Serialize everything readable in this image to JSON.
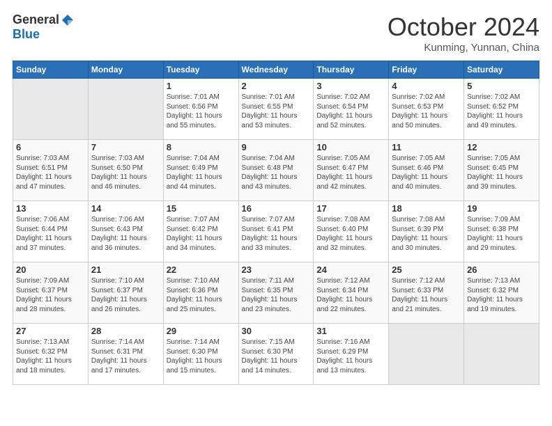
{
  "header": {
    "logo_general": "General",
    "logo_blue": "Blue",
    "month": "October 2024",
    "location": "Kunming, Yunnan, China"
  },
  "weekdays": [
    "Sunday",
    "Monday",
    "Tuesday",
    "Wednesday",
    "Thursday",
    "Friday",
    "Saturday"
  ],
  "weeks": [
    [
      {
        "day": "",
        "info": ""
      },
      {
        "day": "",
        "info": ""
      },
      {
        "day": "1",
        "info": "Sunrise: 7:01 AM\nSunset: 6:56 PM\nDaylight: 11 hours and 55 minutes."
      },
      {
        "day": "2",
        "info": "Sunrise: 7:01 AM\nSunset: 6:55 PM\nDaylight: 11 hours and 53 minutes."
      },
      {
        "day": "3",
        "info": "Sunrise: 7:02 AM\nSunset: 6:54 PM\nDaylight: 11 hours and 52 minutes."
      },
      {
        "day": "4",
        "info": "Sunrise: 7:02 AM\nSunset: 6:53 PM\nDaylight: 11 hours and 50 minutes."
      },
      {
        "day": "5",
        "info": "Sunrise: 7:02 AM\nSunset: 6:52 PM\nDaylight: 11 hours and 49 minutes."
      }
    ],
    [
      {
        "day": "6",
        "info": "Sunrise: 7:03 AM\nSunset: 6:51 PM\nDaylight: 11 hours and 47 minutes."
      },
      {
        "day": "7",
        "info": "Sunrise: 7:03 AM\nSunset: 6:50 PM\nDaylight: 11 hours and 46 minutes."
      },
      {
        "day": "8",
        "info": "Sunrise: 7:04 AM\nSunset: 6:49 PM\nDaylight: 11 hours and 44 minutes."
      },
      {
        "day": "9",
        "info": "Sunrise: 7:04 AM\nSunset: 6:48 PM\nDaylight: 11 hours and 43 minutes."
      },
      {
        "day": "10",
        "info": "Sunrise: 7:05 AM\nSunset: 6:47 PM\nDaylight: 11 hours and 42 minutes."
      },
      {
        "day": "11",
        "info": "Sunrise: 7:05 AM\nSunset: 6:46 PM\nDaylight: 11 hours and 40 minutes."
      },
      {
        "day": "12",
        "info": "Sunrise: 7:05 AM\nSunset: 6:45 PM\nDaylight: 11 hours and 39 minutes."
      }
    ],
    [
      {
        "day": "13",
        "info": "Sunrise: 7:06 AM\nSunset: 6:44 PM\nDaylight: 11 hours and 37 minutes."
      },
      {
        "day": "14",
        "info": "Sunrise: 7:06 AM\nSunset: 6:43 PM\nDaylight: 11 hours and 36 minutes."
      },
      {
        "day": "15",
        "info": "Sunrise: 7:07 AM\nSunset: 6:42 PM\nDaylight: 11 hours and 34 minutes."
      },
      {
        "day": "16",
        "info": "Sunrise: 7:07 AM\nSunset: 6:41 PM\nDaylight: 11 hours and 33 minutes."
      },
      {
        "day": "17",
        "info": "Sunrise: 7:08 AM\nSunset: 6:40 PM\nDaylight: 11 hours and 32 minutes."
      },
      {
        "day": "18",
        "info": "Sunrise: 7:08 AM\nSunset: 6:39 PM\nDaylight: 11 hours and 30 minutes."
      },
      {
        "day": "19",
        "info": "Sunrise: 7:09 AM\nSunset: 6:38 PM\nDaylight: 11 hours and 29 minutes."
      }
    ],
    [
      {
        "day": "20",
        "info": "Sunrise: 7:09 AM\nSunset: 6:37 PM\nDaylight: 11 hours and 28 minutes."
      },
      {
        "day": "21",
        "info": "Sunrise: 7:10 AM\nSunset: 6:37 PM\nDaylight: 11 hours and 26 minutes."
      },
      {
        "day": "22",
        "info": "Sunrise: 7:10 AM\nSunset: 6:36 PM\nDaylight: 11 hours and 25 minutes."
      },
      {
        "day": "23",
        "info": "Sunrise: 7:11 AM\nSunset: 6:35 PM\nDaylight: 11 hours and 23 minutes."
      },
      {
        "day": "24",
        "info": "Sunrise: 7:12 AM\nSunset: 6:34 PM\nDaylight: 11 hours and 22 minutes."
      },
      {
        "day": "25",
        "info": "Sunrise: 7:12 AM\nSunset: 6:33 PM\nDaylight: 11 hours and 21 minutes."
      },
      {
        "day": "26",
        "info": "Sunrise: 7:13 AM\nSunset: 6:32 PM\nDaylight: 11 hours and 19 minutes."
      }
    ],
    [
      {
        "day": "27",
        "info": "Sunrise: 7:13 AM\nSunset: 6:32 PM\nDaylight: 11 hours and 18 minutes."
      },
      {
        "day": "28",
        "info": "Sunrise: 7:14 AM\nSunset: 6:31 PM\nDaylight: 11 hours and 17 minutes."
      },
      {
        "day": "29",
        "info": "Sunrise: 7:14 AM\nSunset: 6:30 PM\nDaylight: 11 hours and 15 minutes."
      },
      {
        "day": "30",
        "info": "Sunrise: 7:15 AM\nSunset: 6:30 PM\nDaylight: 11 hours and 14 minutes."
      },
      {
        "day": "31",
        "info": "Sunrise: 7:16 AM\nSunset: 6:29 PM\nDaylight: 11 hours and 13 minutes."
      },
      {
        "day": "",
        "info": ""
      },
      {
        "day": "",
        "info": ""
      }
    ]
  ]
}
